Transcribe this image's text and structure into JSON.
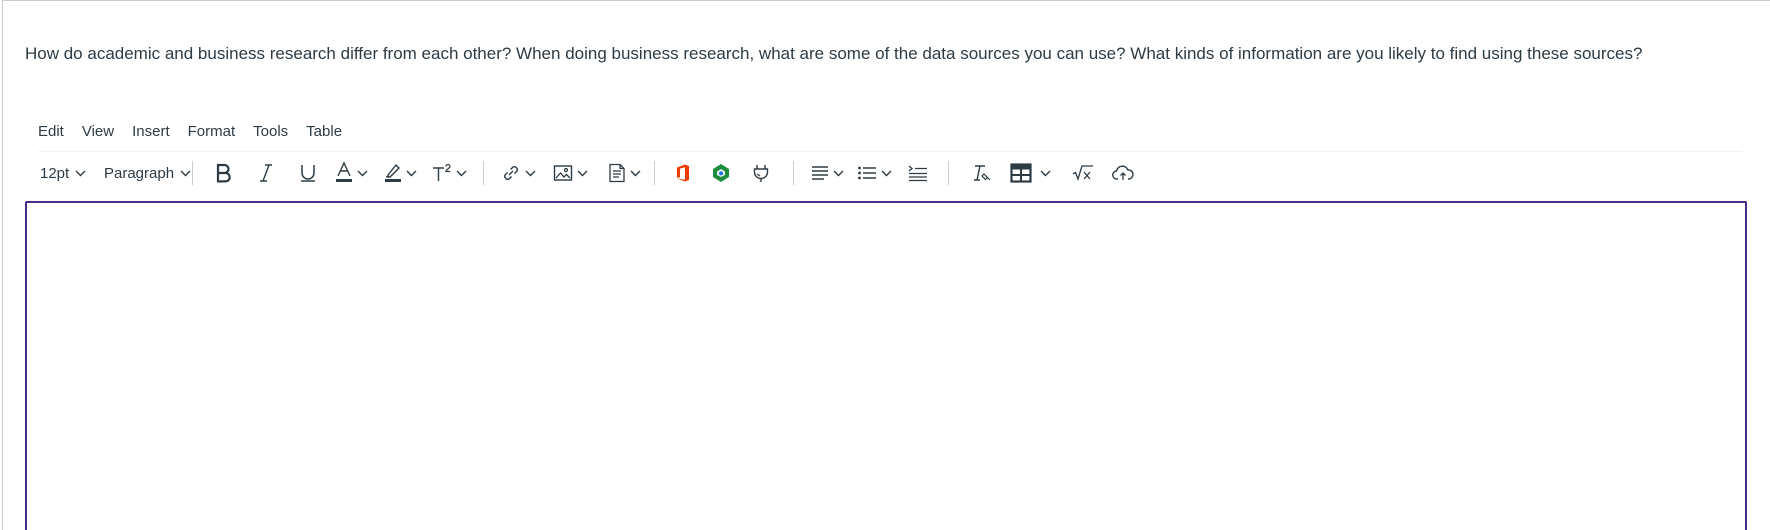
{
  "question": {
    "text": "How do academic and business research differ from each other? When doing business research, what are some of the data sources you can use? What kinds of information are you likely to find using these sources?"
  },
  "menubar": {
    "items": [
      {
        "label": "Edit"
      },
      {
        "label": "View"
      },
      {
        "label": "Insert"
      },
      {
        "label": "Format"
      },
      {
        "label": "Tools"
      },
      {
        "label": "Table"
      }
    ]
  },
  "toolbar": {
    "font_size": "12pt",
    "block_format": "Paragraph",
    "text_color_accent": "#2d3b45",
    "office_icon_color": "#eb3c00",
    "google_icon_color": "#1e8e3e"
  },
  "editor": {
    "border_color": "#4f2a8c",
    "content": ""
  }
}
